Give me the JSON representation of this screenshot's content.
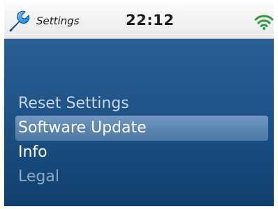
{
  "statusbar": {
    "app_icon": "wrench-icon",
    "title": "Settings",
    "time": "22:12",
    "wifi_icon": "wifi-icon",
    "wifi_color": "#2e9b3c"
  },
  "menu": {
    "items": [
      {
        "label": "Reset Settings",
        "state": "normal"
      },
      {
        "label": "Software Update",
        "state": "selected"
      },
      {
        "label": "Info",
        "state": "normal"
      },
      {
        "label": "Legal",
        "state": "disabled"
      }
    ]
  },
  "colors": {
    "screen_background": "#1e5387",
    "selection_highlight": "#5d86b2"
  }
}
